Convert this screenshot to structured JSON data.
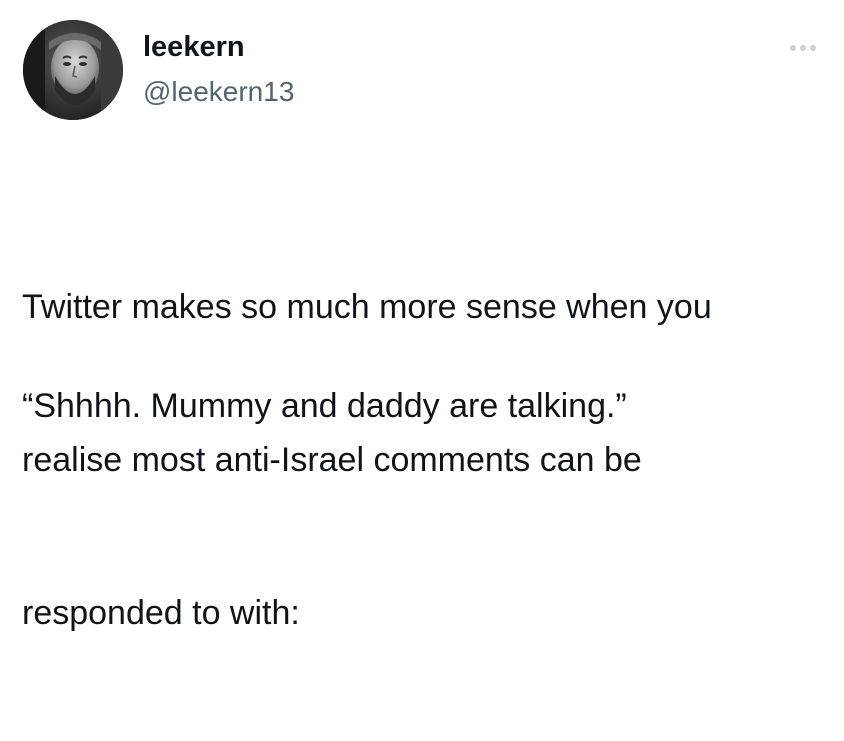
{
  "tweet": {
    "author": {
      "display_name": "leekern",
      "handle": "@leekern13",
      "avatar": "avatar-photo"
    },
    "more_icon": "more-options-icon",
    "text_lines": [
      "Twitter makes so much more sense when you",
      "realise most anti-Israel comments can be",
      "responded to with:"
    ],
    "quote_line": "“Shhhh. Mummy and daddy are talking.”"
  },
  "colors": {
    "text": "#0f1419",
    "secondary_text": "#536471",
    "icon_muted": "#c9d0d6",
    "background": "#ffffff"
  }
}
